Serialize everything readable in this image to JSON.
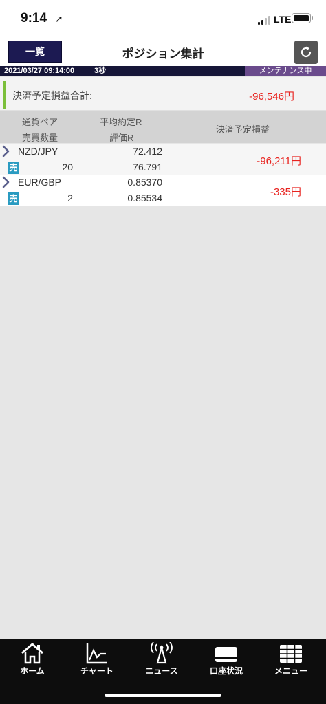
{
  "status_bar": {
    "time": "9:14",
    "network": "LTE"
  },
  "header": {
    "list_button": "一覧",
    "title": "ポジション集計"
  },
  "info_bar": {
    "datetime": "2021/03/27 09:14:00",
    "refresh_interval": "3秒",
    "maintenance": "メンテナンス中"
  },
  "summary": {
    "label": "決済予定損益合計:",
    "value": "-96,546円"
  },
  "columns": {
    "pair": "通貨ペア",
    "quantity": "売買数量",
    "avg_rate": "平均約定R",
    "eval_rate": "評価R",
    "profit_loss": "決済予定損益"
  },
  "positions": [
    {
      "pair": "NZD/JPY",
      "side": "売",
      "quantity": "20",
      "avg_rate": "72.412",
      "eval_rate": "76.791",
      "profit_loss": "-96,211円"
    },
    {
      "pair": "EUR/GBP",
      "side": "売",
      "quantity": "2",
      "avg_rate": "0.85370",
      "eval_rate": "0.85534",
      "profit_loss": "-335円"
    }
  ],
  "nav": [
    {
      "label": "ホーム",
      "icon": "home-icon"
    },
    {
      "label": "チャート",
      "icon": "chart-icon"
    },
    {
      "label": "ニュース",
      "icon": "news-icon"
    },
    {
      "label": "口座状況",
      "icon": "account-icon"
    },
    {
      "label": "メニュー",
      "icon": "menu-icon"
    }
  ],
  "colors": {
    "header_navy": "#1c1a52",
    "negative": "#e8231f",
    "sell_badge": "#2a9bc1",
    "maintenance": "#6a4b8c",
    "accent_green": "#7bbf3a"
  }
}
